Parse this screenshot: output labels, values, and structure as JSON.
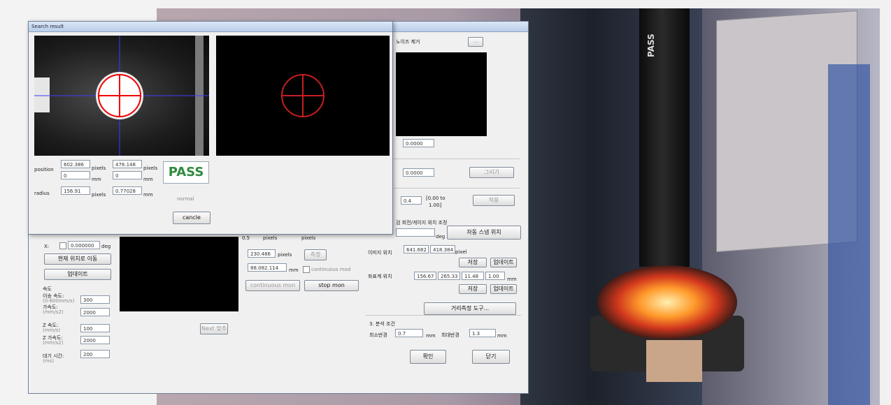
{
  "photo": {
    "camera_label": "PASS"
  },
  "main_window": {
    "noise_label": "노이즈 제거",
    "noise_btn": "...",
    "field1": "0.0000",
    "field2": "0.0000",
    "btn_apply": "그리기",
    "field3": "0.4",
    "note3a": "[0.00 to",
    "note3b": "1.00]",
    "btn_reset": "적용",
    "angle_section": "검 회전/게이지 위치 조정",
    "deg_unit": "deg",
    "btn_auto": "자동 스냅 위치",
    "img_pos_label": "이미지 위치",
    "img_pos_v1": "641.682",
    "img_pos_v2": "418.384",
    "pixel_unit": "pixel",
    "btn_set": "저장",
    "btn_update": "업데이트",
    "real_pos_label": "좌표계 위치",
    "real_vals": [
      "156.67",
      "265.33",
      "11.48",
      "1.00"
    ],
    "unit_mm": "mm",
    "btn_set2": "저장",
    "btn_update2": "업데이트",
    "btn_calc": "거리측정 도구...",
    "analysis_title": "3. 분석 조건",
    "min_label": "최소반경",
    "min_val": "0.7",
    "max_label": "최대반경",
    "max_val": "1.3",
    "btn_ok": "확인",
    "btn_close": "닫기",
    "x_label": "X:",
    "x_val": "0.000000",
    "deg_small": "deg",
    "btn_move_pos": "현재 위치로 이동",
    "btn_update_main": "업데이트",
    "speed_title": "속도",
    "speed1_label": "이송 속도:",
    "speed1_sub": "(0-600mm/s)",
    "speed1_val": "300",
    "speed2_label": "가속도:",
    "speed2_sub": "(mm/s2)",
    "speed2_val": "2000",
    "speed3_label": "Z 속도:",
    "speed3_sub": "(mm/s)",
    "speed3_val": "100",
    "speed4_label": "Z 가속도:",
    "speed4_sub": "(mm/s2)",
    "speed4_val": "2000",
    "speed5_label": "대기 시간:",
    "speed5_sub": "(ms)",
    "speed5_val": "200",
    "c_a": "0.5",
    "c_a_unit": "pixels",
    "c_b": "230.486",
    "c_b_unit": "pixels",
    "c_c": "88.082.114",
    "c_c_unit": "mm",
    "btn_gauge": "측정",
    "checkbox_label": "continuous mod",
    "btn_cont1": "continuous mon",
    "btn_cont2": "stop mon",
    "btn_next": "Next 맞추",
    "row_top_a": "pixels",
    "row_top_b": "pixels"
  },
  "dialog": {
    "title": "Search result",
    "position_label": "position",
    "pos_x_px": "602.386",
    "pos_y_px": "476.148",
    "pos_x_mm": "0",
    "pos_y_mm": "0",
    "radius_label": "radius",
    "rad_px": "156.91",
    "rad_mm": "0.77028",
    "unit_pixels": "pixels",
    "unit_mm": "mm",
    "pass": "PASS",
    "status_sub": "normal",
    "cancel": "cancle"
  }
}
